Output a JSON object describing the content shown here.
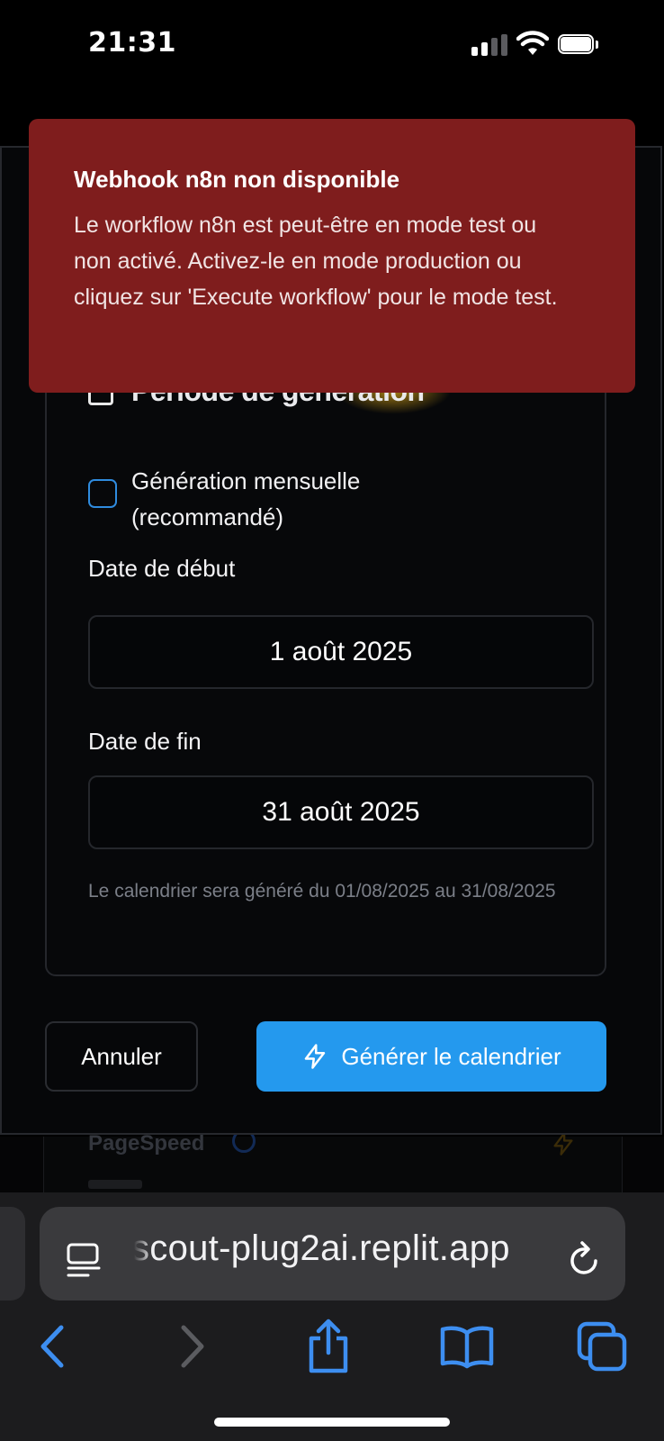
{
  "status_bar": {
    "time": "21:31"
  },
  "toast": {
    "title": "Webhook n8n non disponible",
    "message": "Le workflow n8n est peut-être en mode test ou non activé. Activez-le en mode production ou cliquez sur 'Execute workflow' pour le mode test.",
    "background_color": "#7f1d1d"
  },
  "dialog": {
    "section_title_partial": "Période de génération",
    "monthly_checkbox": {
      "label": "Génération mensuelle (recommandé)",
      "checked": false
    },
    "start_date": {
      "label": "Date de début",
      "value": "1 août 2025"
    },
    "end_date": {
      "label": "Date de fin",
      "value": "31 août 2025"
    },
    "hint": "Le calendrier sera généré du 01/08/2025 au 31/08/2025",
    "cancel_label": "Annuler",
    "generate_label": "Générer le calendrier",
    "accent_color": "#2499ee"
  },
  "background_page": {
    "label": "PageSpeed"
  },
  "browser": {
    "url": "scout-plug2ai.replit.app",
    "toolbar_icons": [
      "back-icon",
      "forward-icon",
      "share-icon",
      "bookmarks-icon",
      "tabs-icon"
    ]
  }
}
